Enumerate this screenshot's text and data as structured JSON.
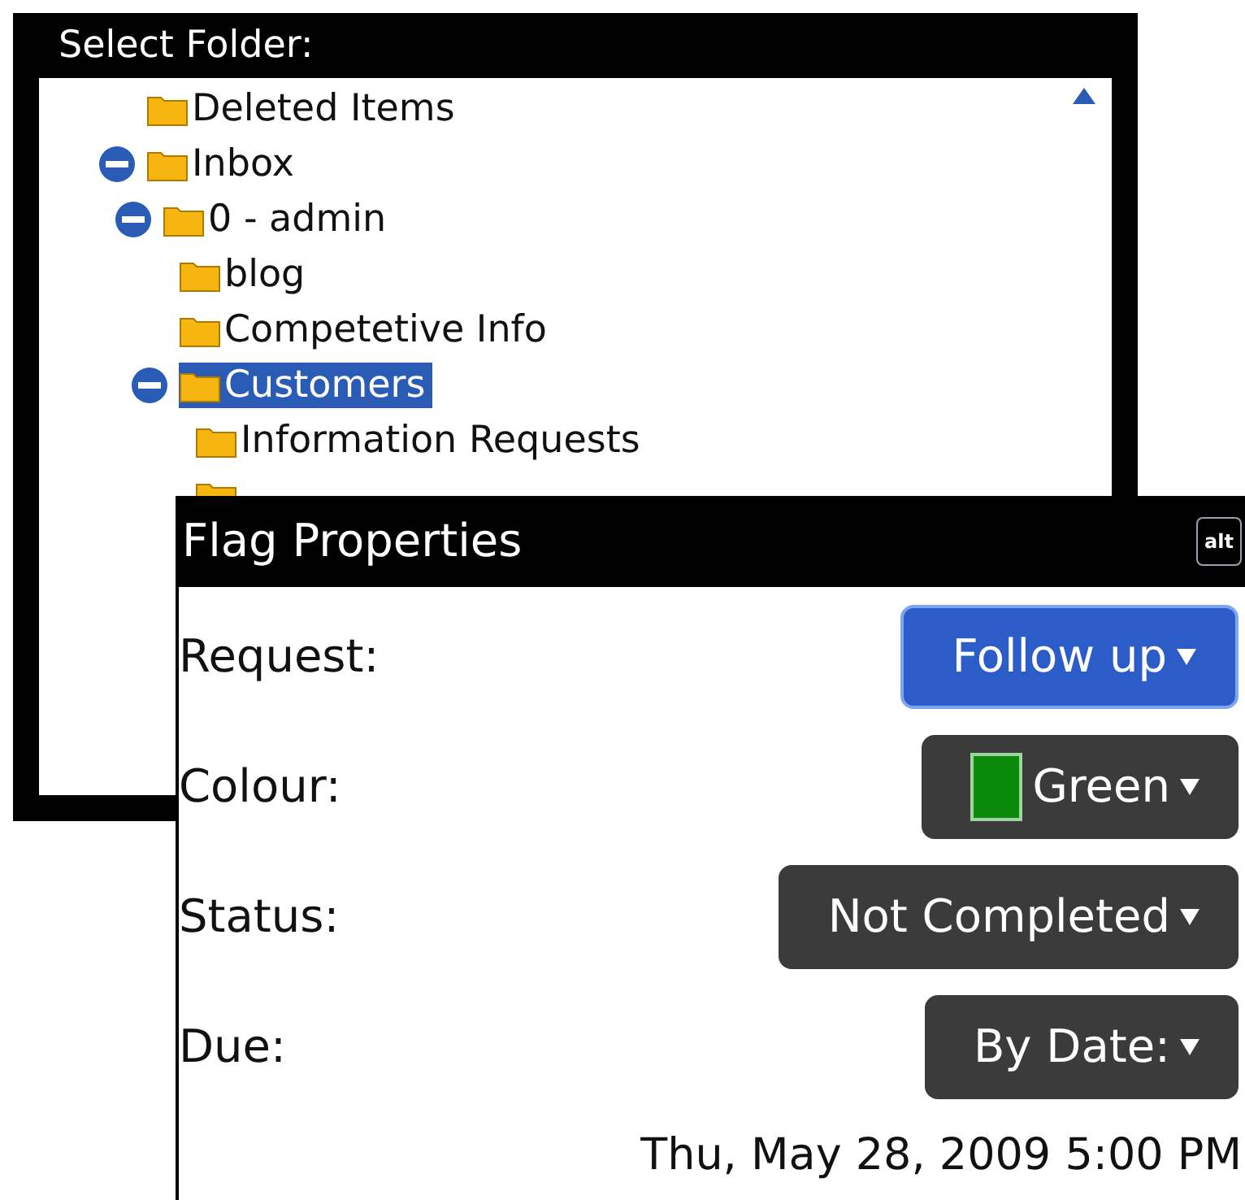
{
  "folder_screen": {
    "title": "Select Folder:",
    "tree": [
      {
        "label": "Deleted Items",
        "selected": false
      },
      {
        "label": "Inbox",
        "expanded": true,
        "selected": false,
        "children": [
          {
            "label": "0 - admin",
            "expanded": true,
            "selected": false,
            "children": [
              {
                "label": "blog",
                "selected": false
              },
              {
                "label": "Competetive Info",
                "selected": false
              },
              {
                "label": "Customers",
                "expanded": true,
                "selected": true,
                "children": [
                  {
                    "label": "Information Requests",
                    "selected": false
                  },
                  {
                    "selected": false
                  }
                ]
              }
            ]
          }
        ]
      }
    ]
  },
  "flag_dialog": {
    "title": "Flag Properties",
    "alt_key": "alt",
    "fields": [
      {
        "kind": "choice",
        "label": "Request:",
        "value": "Follow up",
        "selected": true
      },
      {
        "kind": "swatch",
        "label": "Colour:",
        "value": "Green",
        "color": "#0b8a0b",
        "selected": false
      },
      {
        "kind": "choice",
        "label": "Status:",
        "value": "Not Completed",
        "selected": false
      },
      {
        "kind": "choice",
        "label": "Due:",
        "value": "By Date:",
        "selected": false
      }
    ],
    "due_date": "Thu, May 28, 2009 5:00 PM"
  }
}
